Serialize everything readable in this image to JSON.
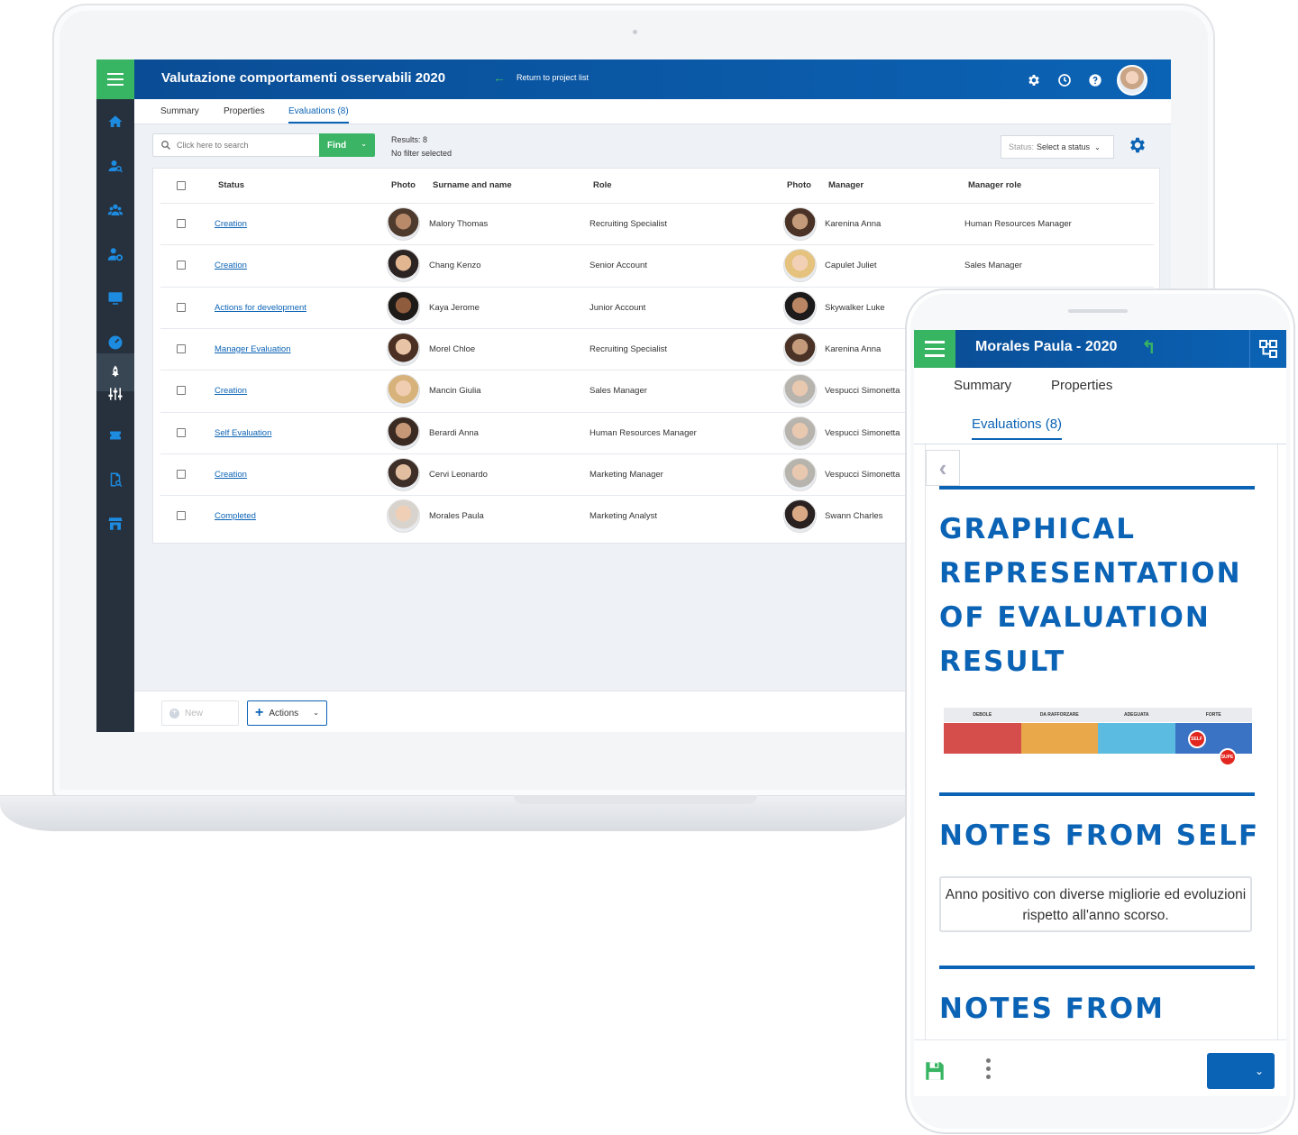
{
  "desktop": {
    "app_title": "Valutazione comportamenti osservabili 2020",
    "return_label": "Return to project list",
    "tabs": [
      {
        "label": "Summary"
      },
      {
        "label": "Properties"
      },
      {
        "label": "Evaluations (8)"
      }
    ],
    "search": {
      "placeholder": "Click here to search",
      "find_label": "Find"
    },
    "results": {
      "count_text": "Results: 8",
      "filter_text": "No filter selected"
    },
    "status_filter": {
      "label": "Status:",
      "value": "Select a status"
    },
    "table": {
      "headers": {
        "status": "Status",
        "photo": "Photo",
        "name": "Surname and name",
        "role": "Role",
        "manager_photo": "Photo",
        "manager": "Manager",
        "manager_role": "Manager role"
      },
      "rows": [
        {
          "status": "Creation",
          "name": "Malory Thomas",
          "role": "Recruiting Specialist",
          "manager": "Karenina Anna",
          "manager_role": "Human Resources Manager"
        },
        {
          "status": "Creation",
          "name": "Chang Kenzo",
          "role": "Senior Account",
          "manager": "Capulet Juliet",
          "manager_role": "Sales Manager"
        },
        {
          "status": "Actions for development",
          "name": "Kaya Jerome",
          "role": "Junior Account",
          "manager": "Skywalker Luke",
          "manager_role": ""
        },
        {
          "status": "Manager Evaluation",
          "name": "Morel Chloe",
          "role": "Recruiting Specialist",
          "manager": "Karenina Anna",
          "manager_role": ""
        },
        {
          "status": "Creation",
          "name": "Mancin Giulia",
          "role": "Sales Manager",
          "manager": "Vespucci Simonetta",
          "manager_role": ""
        },
        {
          "status": "Self Evaluation",
          "name": "Berardi Anna",
          "role": "Human Resources Manager",
          "manager": "Vespucci Simonetta",
          "manager_role": ""
        },
        {
          "status": "Creation",
          "name": "Cervi Leonardo",
          "role": "Marketing Manager",
          "manager": "Vespucci Simonetta",
          "manager_role": ""
        },
        {
          "status": "Completed",
          "name": "Morales Paula",
          "role": "Marketing Analyst",
          "manager": "Swann Charles",
          "manager_role": ""
        }
      ]
    },
    "buttons": {
      "new_label": "New",
      "actions_label": "Actions"
    }
  },
  "mobile": {
    "title": "Morales Paula - 2020",
    "tabs": [
      {
        "label": "Summary"
      },
      {
        "label": "Properties"
      },
      {
        "label": "Evaluations (8)"
      }
    ],
    "sections": {
      "graph_heading": "GRAPHICAL REPRESENTATION OF EVALUATION RESULT",
      "notes_self_heading": "NOTES FROM SELF",
      "notes_self_text": "Anno positivo con diverse migliorie ed evoluzioni rispetto all'anno scorso.",
      "notes_from_heading": "NOTES FROM"
    },
    "scale": {
      "levels": [
        "DEBOLE",
        "DA RAFFORZARE",
        "ADEGUATA",
        "FORTE"
      ],
      "markers": [
        "SELF",
        "SUPE"
      ]
    }
  },
  "colors": {
    "brand_blue": "#0b63b5",
    "accent_green": "#38b562",
    "sidebar_dark": "#26313d",
    "scale": [
      "#d64e4b",
      "#e9a84a",
      "#5bbbe0",
      "#3a73c4"
    ]
  },
  "icons": {
    "sidebar": [
      "home-icon",
      "search-user-icon",
      "users-icon",
      "user-settings-icon",
      "monitor-icon",
      "gauge-icon",
      "rocket-icon",
      "sliders-icon",
      "ticket-icon",
      "report-search-icon",
      "store-icon"
    ],
    "topbar": [
      "gear-icon",
      "clock-icon",
      "help-icon"
    ]
  }
}
